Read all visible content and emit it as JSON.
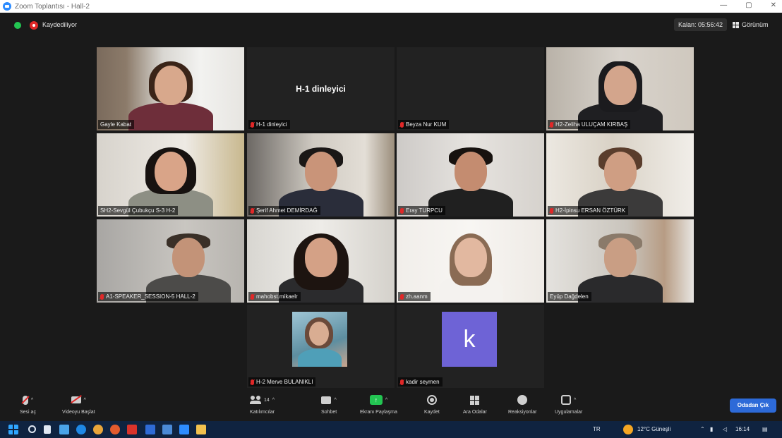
{
  "window": {
    "title": "Zoom Toplantısı - Hall-2"
  },
  "topbar": {
    "recording_label": "Kaydediliyor",
    "timer": "Kalan: 05:56:42",
    "view_label": "Görünüm"
  },
  "tiles": [
    {
      "name": "Gayle Kabat",
      "muted": false,
      "speaking": false,
      "kind": "video"
    },
    {
      "name": "H-1 dinleyici",
      "muted": true,
      "speaking": false,
      "kind": "label",
      "center_text": "H-1 dinleyici"
    },
    {
      "name": "Beyza Nur KUM",
      "muted": true,
      "speaking": false,
      "kind": "empty"
    },
    {
      "name": "H2-Zeliha ULUÇAM KIRBAŞ",
      "muted": true,
      "speaking": false,
      "kind": "video"
    },
    {
      "name": "SH2-Sevgül Çubukçu S-3 H-2",
      "muted": false,
      "speaking": true,
      "kind": "video"
    },
    {
      "name": "Şerif Ahmet DEMİRDAĞ",
      "muted": true,
      "speaking": false,
      "kind": "video"
    },
    {
      "name": "Eray TURPCU",
      "muted": true,
      "speaking": false,
      "kind": "video"
    },
    {
      "name": "H2-İpinsu ERSAN ÖZTÜRK",
      "muted": true,
      "speaking": false,
      "kind": "video"
    },
    {
      "name": "A1-SPEAKER_SESSION-5 HALL-2",
      "muted": true,
      "speaking": false,
      "kind": "video"
    },
    {
      "name": "mahobst.mikaelr",
      "muted": true,
      "speaking": false,
      "kind": "video"
    },
    {
      "name": "zh.aanm",
      "muted": true,
      "speaking": false,
      "kind": "video"
    },
    {
      "name": "Eyüp Dağdelen",
      "muted": true,
      "speaking": false,
      "kind": "video"
    },
    {
      "name": "H-2 Merve BULANIKLI",
      "muted": true,
      "speaking": false,
      "kind": "photo"
    },
    {
      "name": "kadir seymen",
      "muted": true,
      "speaking": false,
      "kind": "avatar",
      "avatar_letter": "k"
    }
  ],
  "toolbar": {
    "unmute_label": "Sesi aç",
    "video_label": "Videoyu Başlat",
    "participants_label": "Katılımcılar",
    "participants_count": "14",
    "chat_label": "Sohbet",
    "share_label": "Ekranı Paylaşma",
    "record_label": "Kaydet",
    "rooms_label": "Ara Odalar",
    "reactions_label": "Reaksiyonlar",
    "apps_label": "Uygulamalar",
    "leave_label": "Odadan Çık"
  },
  "taskbar": {
    "lang": "TR",
    "weather": "12°C Güneşli",
    "time": "16:14"
  },
  "colors": {
    "share_green": "#23c552",
    "leave_blue": "#2d6ad8",
    "speaking_outline": "#c6e04a",
    "muted_red": "#e02828",
    "avatar_purple": "#6e63d6"
  }
}
